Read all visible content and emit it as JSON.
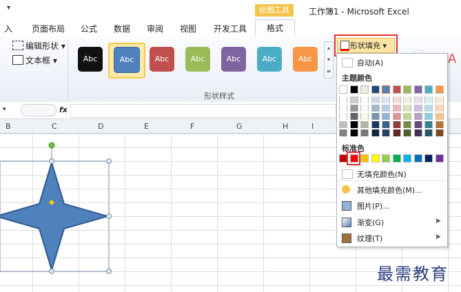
{
  "title_bar": {
    "qat_arrow": "▾",
    "contextual_tools": "绘图工具",
    "window_title": "工作簿1 - Microsoft Excel"
  },
  "tabs": [
    {
      "label": "入"
    },
    {
      "label": "页面布局"
    },
    {
      "label": "公式"
    },
    {
      "label": "数据"
    },
    {
      "label": "审阅"
    },
    {
      "label": "视图"
    },
    {
      "label": "开发工具"
    },
    {
      "label": "格式"
    }
  ],
  "ribbon": {
    "edit_shape": "编辑形状 ▾",
    "text_box": "文本框 ▾",
    "style_sample": "Abc",
    "group_label": "形状样式",
    "shape_fill": "形状填充 ▾",
    "style_colors": [
      "#111111",
      "#4f81bd",
      "#c0504d",
      "#9bbb59",
      "#8064a2",
      "#4bacc6",
      "#f79646"
    ]
  },
  "formula_bar": {
    "fx": "fx"
  },
  "columns": [
    "B",
    "C",
    "D",
    "E",
    "F",
    "G",
    "H",
    "I"
  ],
  "dropdown": {
    "auto": "自动(A)",
    "theme_colors_header": "主题颜色",
    "standard_colors_header": "标准色",
    "no_fill": "无填充颜色(N)",
    "more_colors": "其他填充颜色(M)...",
    "picture": "图片(P)...",
    "gradient": "渐变(G)",
    "texture": "纹理(T)",
    "theme_top": [
      "#ffffff",
      "#000000",
      "#eeece1",
      "#1f497d",
      "#4f81bd",
      "#c0504d",
      "#9bbb59",
      "#8064a2",
      "#4bacc6",
      "#f79646"
    ],
    "standard": [
      "#c00000",
      "#ff0000",
      "#ffc000",
      "#ffff00",
      "#92d050",
      "#00b050",
      "#00b0f0",
      "#0070c0",
      "#002060",
      "#7030a0"
    ]
  },
  "watermark": "最需教育",
  "colors": {
    "accent_red": "#e03030",
    "shape_fill": "#4f81bd",
    "shape_border": "#2f5b8f"
  }
}
